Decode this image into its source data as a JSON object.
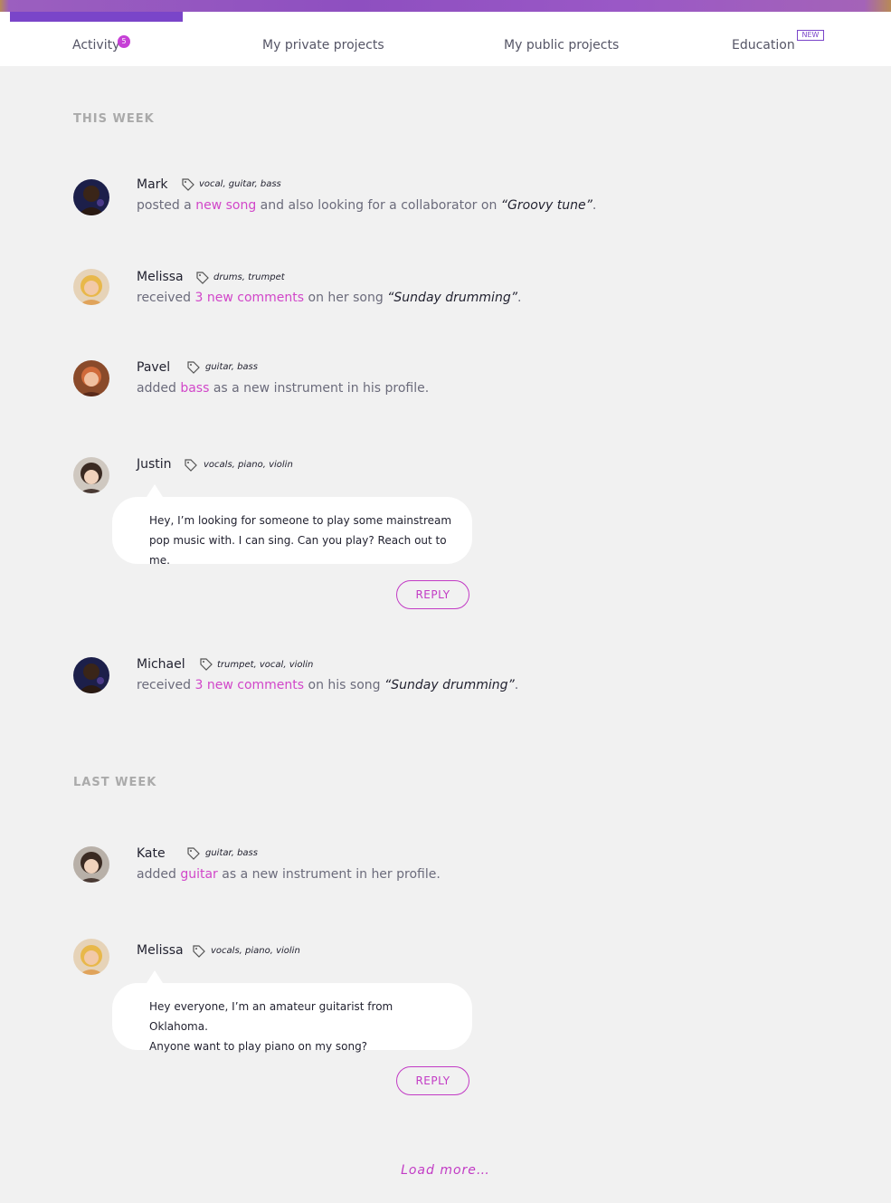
{
  "tabs": [
    {
      "label": "Activity",
      "badge": "5"
    },
    {
      "label": "My private projects"
    },
    {
      "label": "My public projects"
    },
    {
      "label": "Education",
      "badge": "NEW"
    }
  ],
  "sections": {
    "this_week": "THIS WEEK",
    "last_week": "LAST WEEK"
  },
  "feed": [
    {
      "name": "Mark",
      "tags": "vocal, guitar, bass",
      "text1": "posted a ",
      "link": "new song",
      "text2": " and also looking for a collaborator on ",
      "title": "“Groovy tune”",
      "text3": ".",
      "avatar_icon": "avatar-dark-icon"
    },
    {
      "name": "Melissa",
      "tags": "drums, trumpet",
      "text1": "received ",
      "link": "3 new comments",
      "text2": " on her song ",
      "title": "“Sunday drumming”",
      "text3": ".",
      "avatar_icon": "avatar-blonde-icon"
    },
    {
      "name": "Pavel",
      "tags": "guitar, bass",
      "text1": "added ",
      "link": "bass",
      "text2": " as a new instrument in his profile.",
      "avatar_icon": "avatar-ginger-icon"
    },
    {
      "name": "Justin",
      "tags": "vocals, piano, violin",
      "message_line1": "Hey, I’m looking for someone to play some mainstream",
      "message_line2": "pop music with. I can sing. Can you play? Reach out to me.",
      "reply": "REPLY",
      "avatar_icon": "avatar-brunette-icon"
    },
    {
      "name": "Michael",
      "tags": "trumpet, vocal, violin",
      "text1": "received ",
      "link": "3 new comments",
      "text2": " on his song ",
      "title": "“Sunday drumming”",
      "text3": ".",
      "avatar_icon": "avatar-dark-icon"
    },
    {
      "name": "Kate",
      "tags": "guitar, bass",
      "text1": "added ",
      "link": "guitar",
      "text2": " as a new instrument in her profile.",
      "avatar_icon": "avatar-brunette-icon"
    },
    {
      "name": "Melissa",
      "tags": "vocals, piano, violin",
      "message_line1": "Hey everyone, I’m an amateur guitarist from Oklahoma.",
      "message_line2": "Anyone want to play piano on my song?",
      "reply": "REPLY",
      "avatar_icon": "avatar-blonde-icon"
    }
  ],
  "load_more": "Load more…",
  "colors": {
    "accent": "#c23bc5",
    "tab_active": "#7a45c9",
    "background": "#f1f1f1"
  }
}
